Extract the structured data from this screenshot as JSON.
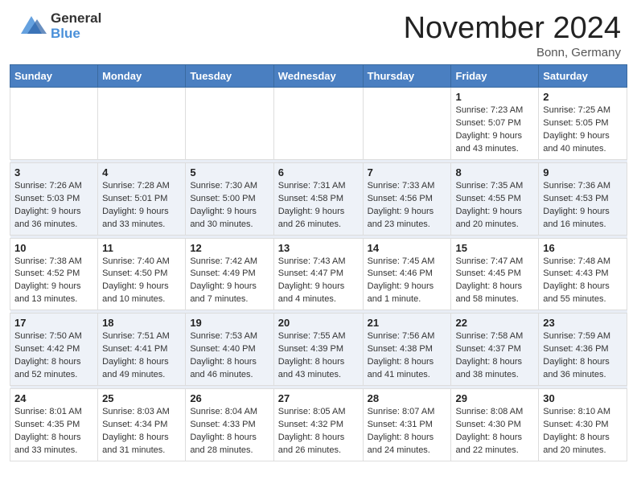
{
  "header": {
    "logo_general": "General",
    "logo_blue": "Blue",
    "month_title": "November 2024",
    "location": "Bonn, Germany"
  },
  "days_of_week": [
    "Sunday",
    "Monday",
    "Tuesday",
    "Wednesday",
    "Thursday",
    "Friday",
    "Saturday"
  ],
  "weeks": [
    {
      "alt": false,
      "days": [
        {
          "number": "",
          "info": ""
        },
        {
          "number": "",
          "info": ""
        },
        {
          "number": "",
          "info": ""
        },
        {
          "number": "",
          "info": ""
        },
        {
          "number": "",
          "info": ""
        },
        {
          "number": "1",
          "info": "Sunrise: 7:23 AM\nSunset: 5:07 PM\nDaylight: 9 hours and 43 minutes."
        },
        {
          "number": "2",
          "info": "Sunrise: 7:25 AM\nSunset: 5:05 PM\nDaylight: 9 hours and 40 minutes."
        }
      ]
    },
    {
      "alt": true,
      "days": [
        {
          "number": "3",
          "info": "Sunrise: 7:26 AM\nSunset: 5:03 PM\nDaylight: 9 hours and 36 minutes."
        },
        {
          "number": "4",
          "info": "Sunrise: 7:28 AM\nSunset: 5:01 PM\nDaylight: 9 hours and 33 minutes."
        },
        {
          "number": "5",
          "info": "Sunrise: 7:30 AM\nSunset: 5:00 PM\nDaylight: 9 hours and 30 minutes."
        },
        {
          "number": "6",
          "info": "Sunrise: 7:31 AM\nSunset: 4:58 PM\nDaylight: 9 hours and 26 minutes."
        },
        {
          "number": "7",
          "info": "Sunrise: 7:33 AM\nSunset: 4:56 PM\nDaylight: 9 hours and 23 minutes."
        },
        {
          "number": "8",
          "info": "Sunrise: 7:35 AM\nSunset: 4:55 PM\nDaylight: 9 hours and 20 minutes."
        },
        {
          "number": "9",
          "info": "Sunrise: 7:36 AM\nSunset: 4:53 PM\nDaylight: 9 hours and 16 minutes."
        }
      ]
    },
    {
      "alt": false,
      "days": [
        {
          "number": "10",
          "info": "Sunrise: 7:38 AM\nSunset: 4:52 PM\nDaylight: 9 hours and 13 minutes."
        },
        {
          "number": "11",
          "info": "Sunrise: 7:40 AM\nSunset: 4:50 PM\nDaylight: 9 hours and 10 minutes."
        },
        {
          "number": "12",
          "info": "Sunrise: 7:42 AM\nSunset: 4:49 PM\nDaylight: 9 hours and 7 minutes."
        },
        {
          "number": "13",
          "info": "Sunrise: 7:43 AM\nSunset: 4:47 PM\nDaylight: 9 hours and 4 minutes."
        },
        {
          "number": "14",
          "info": "Sunrise: 7:45 AM\nSunset: 4:46 PM\nDaylight: 9 hours and 1 minute."
        },
        {
          "number": "15",
          "info": "Sunrise: 7:47 AM\nSunset: 4:45 PM\nDaylight: 8 hours and 58 minutes."
        },
        {
          "number": "16",
          "info": "Sunrise: 7:48 AM\nSunset: 4:43 PM\nDaylight: 8 hours and 55 minutes."
        }
      ]
    },
    {
      "alt": true,
      "days": [
        {
          "number": "17",
          "info": "Sunrise: 7:50 AM\nSunset: 4:42 PM\nDaylight: 8 hours and 52 minutes."
        },
        {
          "number": "18",
          "info": "Sunrise: 7:51 AM\nSunset: 4:41 PM\nDaylight: 8 hours and 49 minutes."
        },
        {
          "number": "19",
          "info": "Sunrise: 7:53 AM\nSunset: 4:40 PM\nDaylight: 8 hours and 46 minutes."
        },
        {
          "number": "20",
          "info": "Sunrise: 7:55 AM\nSunset: 4:39 PM\nDaylight: 8 hours and 43 minutes."
        },
        {
          "number": "21",
          "info": "Sunrise: 7:56 AM\nSunset: 4:38 PM\nDaylight: 8 hours and 41 minutes."
        },
        {
          "number": "22",
          "info": "Sunrise: 7:58 AM\nSunset: 4:37 PM\nDaylight: 8 hours and 38 minutes."
        },
        {
          "number": "23",
          "info": "Sunrise: 7:59 AM\nSunset: 4:36 PM\nDaylight: 8 hours and 36 minutes."
        }
      ]
    },
    {
      "alt": false,
      "days": [
        {
          "number": "24",
          "info": "Sunrise: 8:01 AM\nSunset: 4:35 PM\nDaylight: 8 hours and 33 minutes."
        },
        {
          "number": "25",
          "info": "Sunrise: 8:03 AM\nSunset: 4:34 PM\nDaylight: 8 hours and 31 minutes."
        },
        {
          "number": "26",
          "info": "Sunrise: 8:04 AM\nSunset: 4:33 PM\nDaylight: 8 hours and 28 minutes."
        },
        {
          "number": "27",
          "info": "Sunrise: 8:05 AM\nSunset: 4:32 PM\nDaylight: 8 hours and 26 minutes."
        },
        {
          "number": "28",
          "info": "Sunrise: 8:07 AM\nSunset: 4:31 PM\nDaylight: 8 hours and 24 minutes."
        },
        {
          "number": "29",
          "info": "Sunrise: 8:08 AM\nSunset: 4:30 PM\nDaylight: 8 hours and 22 minutes."
        },
        {
          "number": "30",
          "info": "Sunrise: 8:10 AM\nSunset: 4:30 PM\nDaylight: 8 hours and 20 minutes."
        }
      ]
    }
  ]
}
